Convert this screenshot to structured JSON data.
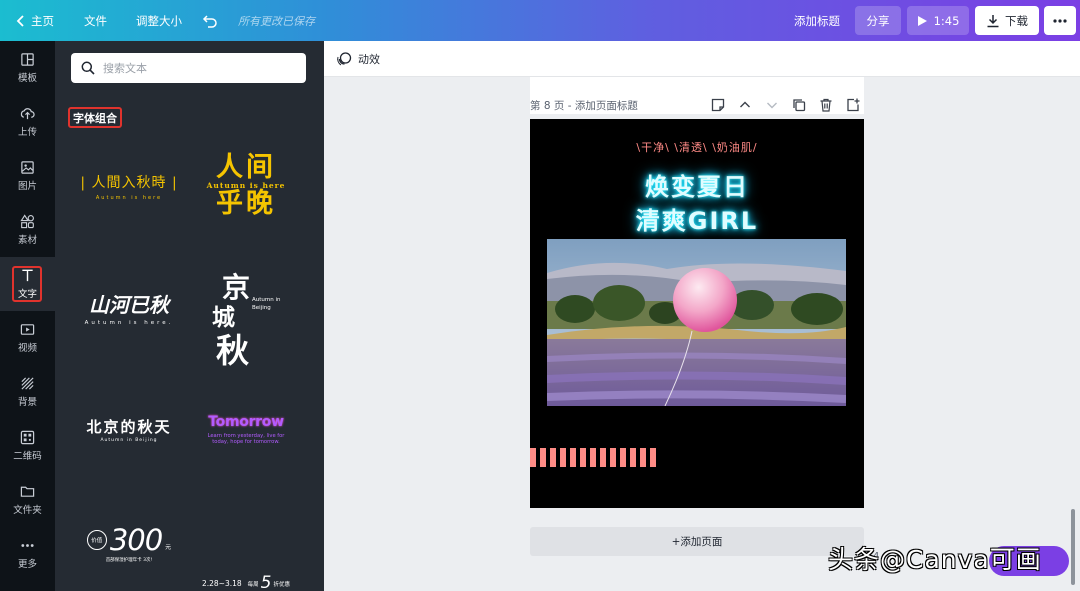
{
  "topbar": {
    "home": "主页",
    "file": "文件",
    "resize": "调整大小",
    "saved": "所有更改已保存",
    "add_title": "添加标题",
    "share": "分享",
    "play_time": "1:45",
    "download": "下载"
  },
  "rail": {
    "items": [
      {
        "label": "模板",
        "icon": "template-icon"
      },
      {
        "label": "上传",
        "icon": "upload-icon"
      },
      {
        "label": "图片",
        "icon": "image-icon"
      },
      {
        "label": "素材",
        "icon": "elements-icon"
      },
      {
        "label": "文字",
        "icon": "text-icon"
      },
      {
        "label": "视频",
        "icon": "video-icon"
      },
      {
        "label": "背景",
        "icon": "background-icon"
      },
      {
        "label": "二维码",
        "icon": "qr-code-icon"
      },
      {
        "label": "文件夹",
        "icon": "folder-icon"
      },
      {
        "label": "更多",
        "icon": "more-icon"
      }
    ],
    "active": "文字"
  },
  "panel": {
    "search_placeholder": "搜索文本",
    "section_title": "字体组合",
    "tiles": {
      "t1": {
        "main": "| 人間入秋時 |",
        "sub": "Autumn is here"
      },
      "t2": {
        "main1": "人间",
        "sub": "Autumn is here",
        "main2": "乎晚"
      },
      "t3": {
        "main": "山河已秋",
        "sub": "Autumn is here."
      },
      "t4": {
        "c1": "京",
        "c2": "城",
        "c3": "秋",
        "sub1": "Autumn in",
        "sub2": "Beijing"
      },
      "t5": {
        "main": "北京的秋天",
        "sub": "Autumn in Beijing"
      },
      "t6": {
        "main": "Tomorrow",
        "sub1": "Learn from yesterday, live for",
        "sub2": "today, hope for tomorrow."
      },
      "t7": {
        "badge": "价值",
        "number": "300",
        "unit": "元",
        "note": "首部保湿护理年卡 3次!"
      },
      "t8": {
        "dates": "2.28~3.18",
        "prefix": "每周",
        "number": "5",
        "suffix": "折优惠"
      }
    }
  },
  "editor": {
    "effects": "动效",
    "page_label": "第 8 页 - 添加页面标题",
    "add_page": "+添加页面",
    "zoom": "4"
  },
  "design": {
    "tagline": "\\干净\\ \\清透\\ \\奶油肌/",
    "title_line1": "焕变夏日",
    "title_line2": "清爽GIRL"
  },
  "watermark": "头条@Canva可画",
  "colors": {
    "highlight": "#e0332d",
    "neon_glow": "#19d6ff",
    "stripe": "#ff8c86",
    "tagline": "#ff8a86",
    "brand_purple": "#7b3fe4"
  }
}
